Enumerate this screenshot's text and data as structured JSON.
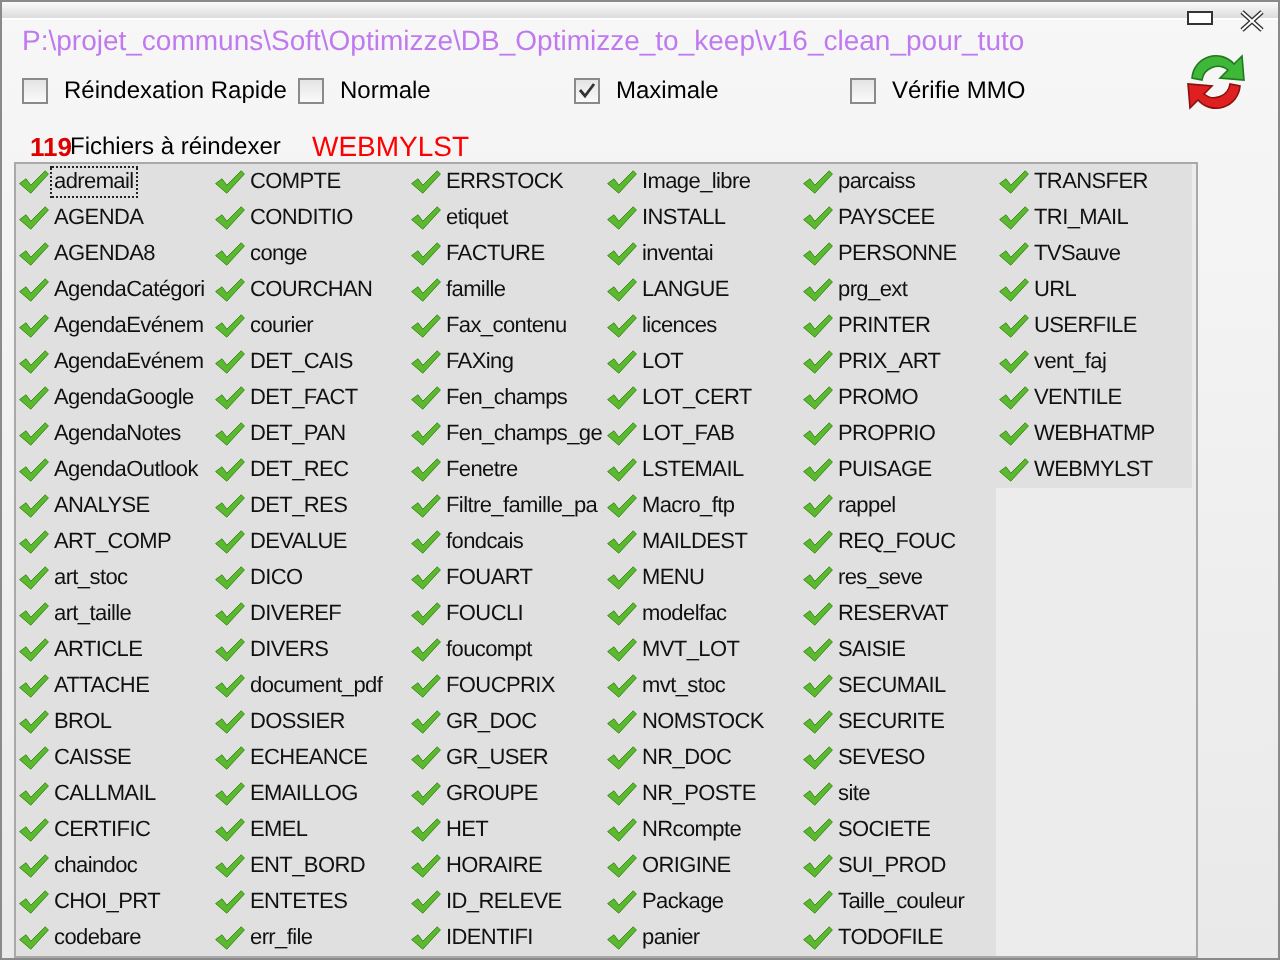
{
  "window": {
    "path": "P:\\projet_communs\\Soft\\Optimizze\\DB_Optimizze_to_keep\\v16_clean_pour_tuto"
  },
  "options": [
    {
      "label": "Réindexation Rapide",
      "checked": false
    },
    {
      "label": "Normale",
      "checked": false
    },
    {
      "label": "Maximale",
      "checked": true
    },
    {
      "label": "Vérifie MMO",
      "checked": false
    }
  ],
  "status": {
    "count": "119",
    "label": "Fichiers à réindexer",
    "current": "WEBMYLST"
  },
  "files": [
    {
      "name": "adremail",
      "selected": true
    },
    {
      "name": "AGENDA",
      "selected": false
    },
    {
      "name": "AGENDA8",
      "selected": false
    },
    {
      "name": "AgendaCatégori",
      "selected": false
    },
    {
      "name": "AgendaEvénem",
      "selected": false
    },
    {
      "name": "AgendaEvénem",
      "selected": false
    },
    {
      "name": "AgendaGoogle",
      "selected": false
    },
    {
      "name": "AgendaNotes",
      "selected": false
    },
    {
      "name": "AgendaOutlook",
      "selected": false
    },
    {
      "name": "ANALYSE",
      "selected": false
    },
    {
      "name": "ART_COMP",
      "selected": false
    },
    {
      "name": "art_stoc",
      "selected": false
    },
    {
      "name": "art_taille",
      "selected": false
    },
    {
      "name": "ARTICLE",
      "selected": false
    },
    {
      "name": "ATTACHE",
      "selected": false
    },
    {
      "name": "BROL",
      "selected": false
    },
    {
      "name": "CAISSE",
      "selected": false
    },
    {
      "name": "CALLMAIL",
      "selected": false
    },
    {
      "name": "CERTIFIC",
      "selected": false
    },
    {
      "name": "chaindoc",
      "selected": false
    },
    {
      "name": "CHOI_PRT",
      "selected": false
    },
    {
      "name": "codebare",
      "selected": false
    },
    {
      "name": "COMPTE",
      "selected": false
    },
    {
      "name": "CONDITIO",
      "selected": false
    },
    {
      "name": "conge",
      "selected": false
    },
    {
      "name": "COURCHAN",
      "selected": false
    },
    {
      "name": "courier",
      "selected": false
    },
    {
      "name": "DET_CAIS",
      "selected": false
    },
    {
      "name": "DET_FACT",
      "selected": false
    },
    {
      "name": "DET_PAN",
      "selected": false
    },
    {
      "name": "DET_REC",
      "selected": false
    },
    {
      "name": "DET_RES",
      "selected": false
    },
    {
      "name": "DEVALUE",
      "selected": false
    },
    {
      "name": "DICO",
      "selected": false
    },
    {
      "name": "DIVEREF",
      "selected": false
    },
    {
      "name": "DIVERS",
      "selected": false
    },
    {
      "name": "document_pdf",
      "selected": false
    },
    {
      "name": "DOSSIER",
      "selected": false
    },
    {
      "name": "ECHEANCE",
      "selected": false
    },
    {
      "name": "EMAILLOG",
      "selected": false
    },
    {
      "name": "EMEL",
      "selected": false
    },
    {
      "name": "ENT_BORD",
      "selected": false
    },
    {
      "name": "ENTETES",
      "selected": false
    },
    {
      "name": "err_file",
      "selected": false
    },
    {
      "name": "ERRSTOCK",
      "selected": false
    },
    {
      "name": "etiquet",
      "selected": false
    },
    {
      "name": "FACTURE",
      "selected": false
    },
    {
      "name": "famille",
      "selected": false
    },
    {
      "name": "Fax_contenu",
      "selected": false
    },
    {
      "name": "FAXing",
      "selected": false
    },
    {
      "name": "Fen_champs",
      "selected": false
    },
    {
      "name": "Fen_champs_ge",
      "selected": false
    },
    {
      "name": "Fenetre",
      "selected": false
    },
    {
      "name": "Filtre_famille_pa",
      "selected": false
    },
    {
      "name": "fondcais",
      "selected": false
    },
    {
      "name": "FOUART",
      "selected": false
    },
    {
      "name": "FOUCLI",
      "selected": false
    },
    {
      "name": "foucompt",
      "selected": false
    },
    {
      "name": "FOUCPRIX",
      "selected": false
    },
    {
      "name": "GR_DOC",
      "selected": false
    },
    {
      "name": "GR_USER",
      "selected": false
    },
    {
      "name": "GROUPE",
      "selected": false
    },
    {
      "name": "HET",
      "selected": false
    },
    {
      "name": "HORAIRE",
      "selected": false
    },
    {
      "name": "ID_RELEVE",
      "selected": false
    },
    {
      "name": "IDENTIFI",
      "selected": false
    },
    {
      "name": "Image_libre",
      "selected": false
    },
    {
      "name": "INSTALL",
      "selected": false
    },
    {
      "name": "inventai",
      "selected": false
    },
    {
      "name": "LANGUE",
      "selected": false
    },
    {
      "name": "licences",
      "selected": false
    },
    {
      "name": "LOT",
      "selected": false
    },
    {
      "name": "LOT_CERT",
      "selected": false
    },
    {
      "name": "LOT_FAB",
      "selected": false
    },
    {
      "name": "LSTEMAIL",
      "selected": false
    },
    {
      "name": "Macro_ftp",
      "selected": false
    },
    {
      "name": "MAILDEST",
      "selected": false
    },
    {
      "name": "MENU",
      "selected": false
    },
    {
      "name": "modelfac",
      "selected": false
    },
    {
      "name": "MVT_LOT",
      "selected": false
    },
    {
      "name": "mvt_stoc",
      "selected": false
    },
    {
      "name": "NOMSTOCK",
      "selected": false
    },
    {
      "name": "NR_DOC",
      "selected": false
    },
    {
      "name": "NR_POSTE",
      "selected": false
    },
    {
      "name": "NRcompte",
      "selected": false
    },
    {
      "name": "ORIGINE",
      "selected": false
    },
    {
      "name": "Package",
      "selected": false
    },
    {
      "name": "panier",
      "selected": false
    },
    {
      "name": "parcaiss",
      "selected": false
    },
    {
      "name": "PAYSCEE",
      "selected": false
    },
    {
      "name": "PERSONNE",
      "selected": false
    },
    {
      "name": "prg_ext",
      "selected": false
    },
    {
      "name": "PRINTER",
      "selected": false
    },
    {
      "name": "PRIX_ART",
      "selected": false
    },
    {
      "name": "PROMO",
      "selected": false
    },
    {
      "name": "PROPRIO",
      "selected": false
    },
    {
      "name": "PUISAGE",
      "selected": false
    },
    {
      "name": "rappel",
      "selected": false
    },
    {
      "name": "REQ_FOUC",
      "selected": false
    },
    {
      "name": "res_seve",
      "selected": false
    },
    {
      "name": "RESERVAT",
      "selected": false
    },
    {
      "name": "SAISIE",
      "selected": false
    },
    {
      "name": "SECUMAIL",
      "selected": false
    },
    {
      "name": "SECURITE",
      "selected": false
    },
    {
      "name": "SEVESO",
      "selected": false
    },
    {
      "name": "site",
      "selected": false
    },
    {
      "name": "SOCIETE",
      "selected": false
    },
    {
      "name": "SUI_PROD",
      "selected": false
    },
    {
      "name": "Taille_couleur",
      "selected": false
    },
    {
      "name": "TODOFILE",
      "selected": false
    },
    {
      "name": "TRANSFER",
      "selected": false
    },
    {
      "name": "TRI_MAIL",
      "selected": false
    },
    {
      "name": "TVSauve",
      "selected": false
    },
    {
      "name": "URL",
      "selected": false
    },
    {
      "name": "USERFILE",
      "selected": false
    },
    {
      "name": "vent_faj",
      "selected": false
    },
    {
      "name": "VENTILE",
      "selected": false
    },
    {
      "name": "WEBHATMP",
      "selected": false
    },
    {
      "name": "WEBMYLST",
      "selected": false
    }
  ]
}
